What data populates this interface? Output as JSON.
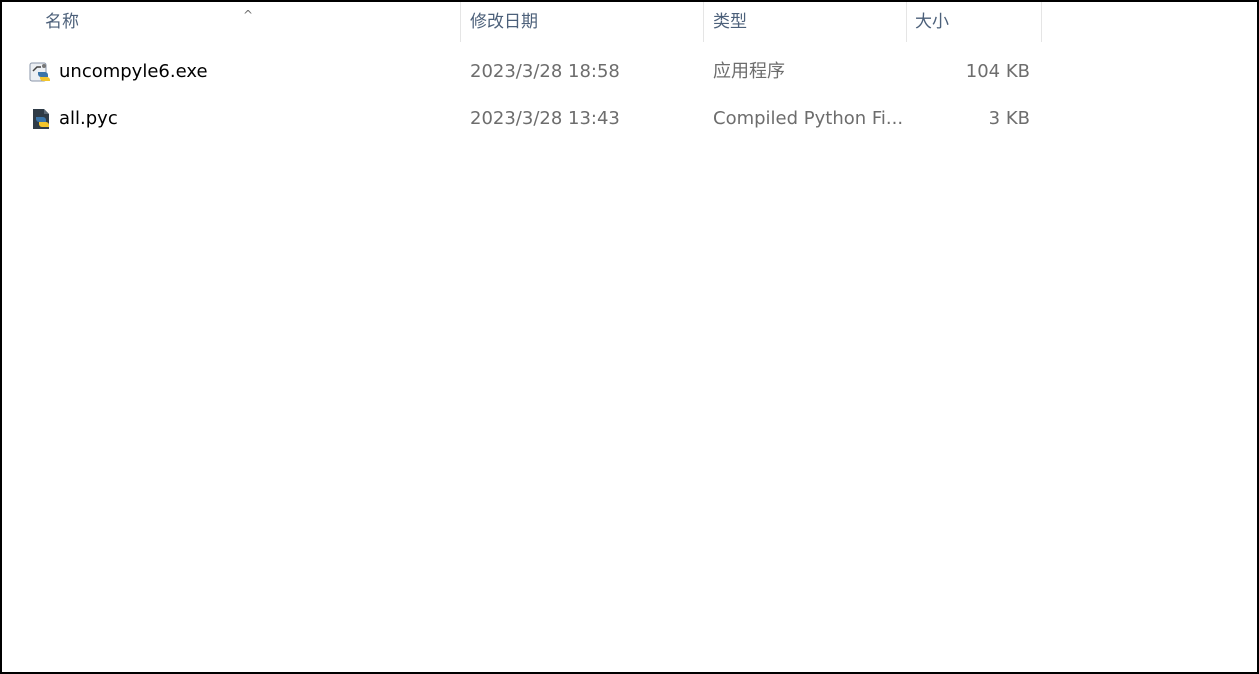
{
  "columns": {
    "name": "名称",
    "date": "修改日期",
    "type": "类型",
    "size": "大小"
  },
  "sort_indicator": "^",
  "files": [
    {
      "name": "uncompyle6.exe",
      "date": "2023/3/28 18:58",
      "type": "应用程序",
      "size": "104 KB",
      "icon": "python-exe-icon"
    },
    {
      "name": "all.pyc",
      "date": "2023/3/28 13:43",
      "type": "Compiled Python Fi...",
      "size": "3 KB",
      "icon": "python-compiled-file-icon"
    }
  ],
  "colors": {
    "header_text": "#4c607a",
    "muted_text": "#6d6d6d",
    "python_blue": "#3a74a8",
    "python_yellow": "#f3c52c"
  }
}
